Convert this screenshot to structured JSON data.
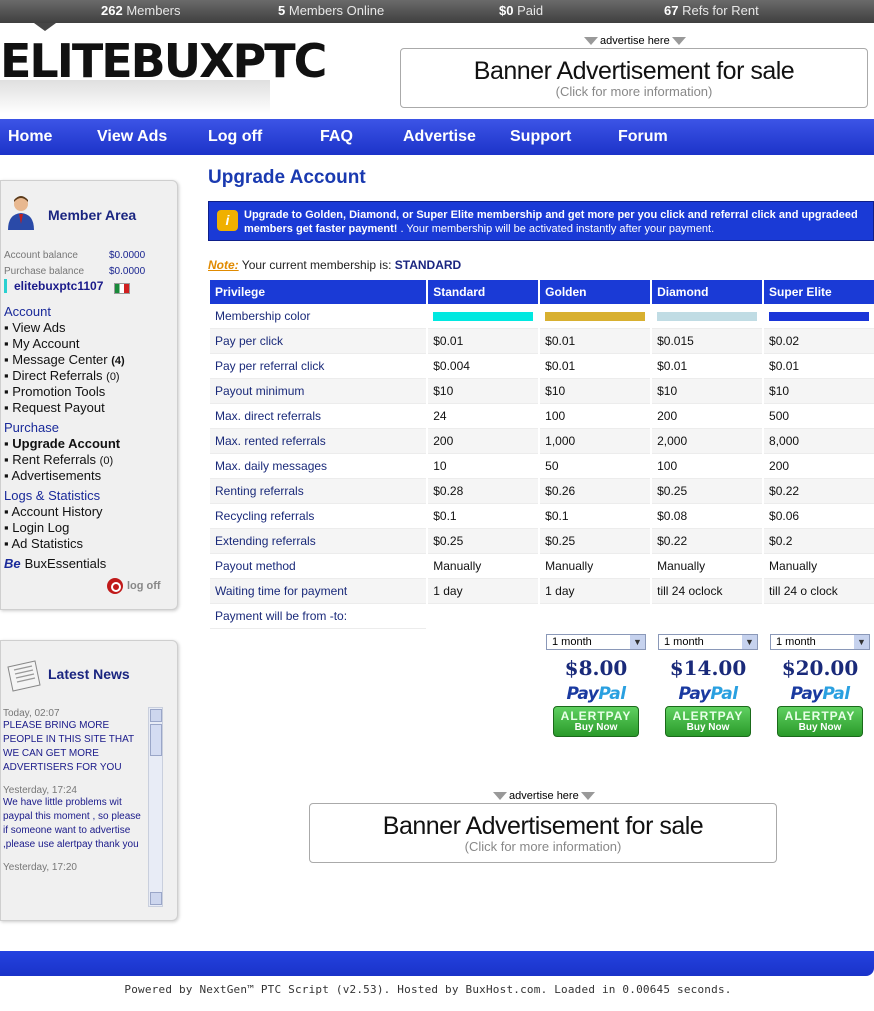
{
  "stats": {
    "members_count": "262",
    "members_label": "Members",
    "online_count": "5",
    "online_label": "Members Online",
    "paid_amount": "$0",
    "paid_label": "Paid",
    "refs_count": "67",
    "refs_label": "Refs for Rent"
  },
  "logo": "ELITEBUXPTC",
  "top_banner": {
    "advertise_label": "advertise here",
    "title": "Banner Advertisement for sale",
    "subtitle": "(Click for more information)"
  },
  "nav": [
    "Home",
    "View Ads",
    "Log off",
    "FAQ",
    "Advertise",
    "Support",
    "Forum"
  ],
  "member_area": {
    "title": "Member Area",
    "account_balance_label": "Account balance",
    "account_balance": "$0.0000",
    "purchase_balance_label": "Purchase balance",
    "purchase_balance": "$0.0000",
    "username": "elitebuxptc1107",
    "account_section": "Account",
    "account_items": [
      {
        "label": "View Ads",
        "count": ""
      },
      {
        "label": "My Account",
        "count": ""
      },
      {
        "label": "Message Center",
        "count": "(4)"
      },
      {
        "label": "Direct Referrals",
        "count": "(0)"
      },
      {
        "label": "Promotion Tools",
        "count": ""
      },
      {
        "label": "Request Payout",
        "count": ""
      }
    ],
    "purchase_section": "Purchase",
    "purchase_items": [
      {
        "label": "Upgrade Account",
        "count": ""
      },
      {
        "label": "Rent Referrals",
        "count": "(0)"
      },
      {
        "label": "Advertisements",
        "count": ""
      }
    ],
    "logs_section": "Logs & Statistics",
    "logs_items": [
      "Account History",
      "Login Log",
      "Ad Statistics"
    ],
    "buxessentials": "BuxEssentials",
    "logoff": "log off"
  },
  "news": {
    "title": "Latest News",
    "items": [
      {
        "date": "Today, 02:07",
        "text": "PLEASE BRING MORE PEOPLE IN THIS SITE THAT WE CAN GET MORE ADVERTISERS FOR YOU"
      },
      {
        "date": "Yesterday, 17:24",
        "text": "We have little problems wit paypal this moment , so please if someone want to advertise ,please use alertpay thank you"
      },
      {
        "date": "Yesterday, 17:20",
        "text": ""
      }
    ]
  },
  "main": {
    "title": "Upgrade Account",
    "info_bold": "Upgrade to Golden, Diamond, or Super Elite membership and get more per you click and referral click and upgradeed members get faster payment!",
    "info_rest": " . Your membership will be activated instantly after your payment.",
    "note_label": "Note:",
    "note_text": " Your current membership is: ",
    "membership": "STANDARD",
    "table": {
      "headers": [
        "Privilege",
        "Standard",
        "Golden",
        "Diamond",
        "Super Elite"
      ],
      "colors": [
        "#00e8e0",
        "#d8b030",
        "#c0dce4",
        "#1a35d8"
      ],
      "membership_color_label": "Membership color",
      "rows": [
        [
          "Pay per click",
          "$0.01",
          "$0.01",
          "$0.015",
          "$0.02"
        ],
        [
          "Pay per referral click",
          "$0.004",
          "$0.01",
          "$0.01",
          "$0.01"
        ],
        [
          "Payout minimum",
          "$10",
          "$10",
          "$10",
          "$10"
        ],
        [
          "Max. direct referrals",
          "24",
          "100",
          "200",
          "500"
        ],
        [
          "Max. rented referrals",
          "200",
          "1,000",
          "2,000",
          "8,000"
        ],
        [
          "Max. daily messages",
          "10",
          "50",
          "100",
          "200"
        ],
        [
          "Renting referrals",
          "$0.28",
          "$0.26",
          "$0.25",
          "$0.22"
        ],
        [
          "Recycling referrals",
          "$0.1",
          "$0.1",
          "$0.08",
          "$0.06"
        ],
        [
          "Extending referrals",
          "$0.25",
          "$0.25",
          "$0.22",
          "$0.2"
        ],
        [
          "Payout method",
          "Manually",
          "Manually",
          "Manually",
          "Manually"
        ],
        [
          "Waiting time for payment",
          "1 day",
          "1 day",
          "till 24 oclock",
          "till 24 o clock"
        ],
        [
          "Payment will be from -to:",
          "",
          "",
          "",
          ""
        ]
      ]
    },
    "plans": [
      {
        "duration": "1 month",
        "price": "$8.00"
      },
      {
        "duration": "1 month",
        "price": "$14.00"
      },
      {
        "duration": "1 month",
        "price": "$20.00"
      }
    ],
    "paypal_a": "Pay",
    "paypal_b": "Pal",
    "alertpay_label": "ALERTPAY",
    "buy_now": "Buy Now"
  },
  "bottom_banner": {
    "advertise_label": "advertise here",
    "title": "Banner Advertisement for sale",
    "subtitle": "(Click for more information)"
  },
  "footer": "Powered by NextGen™ PTC Script (v2.53). Hosted by BuxHost.com. Loaded in 0.00645 seconds."
}
